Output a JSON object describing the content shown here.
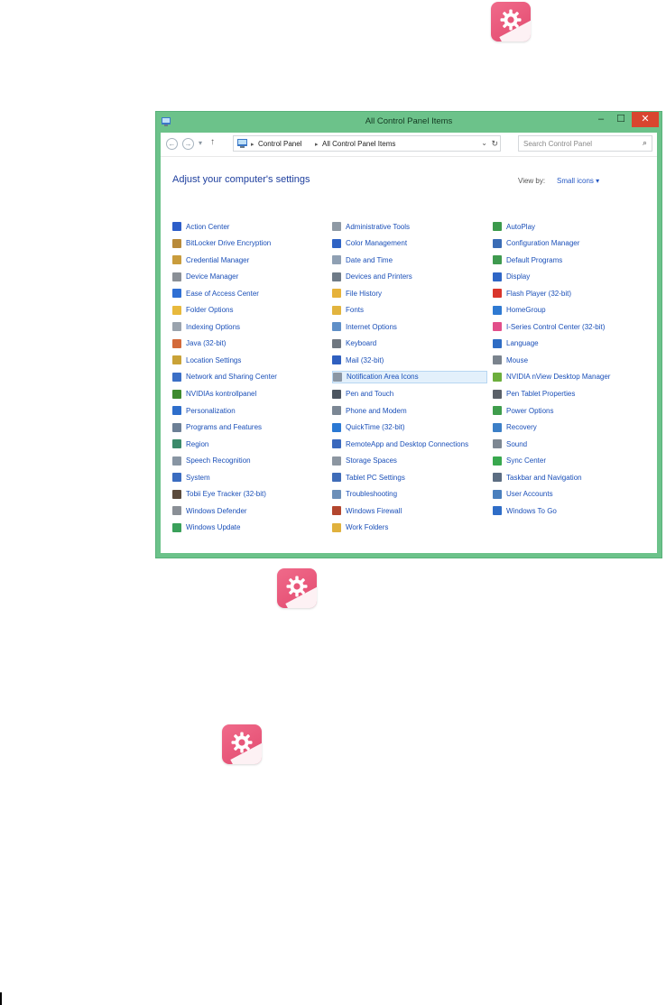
{
  "window": {
    "title": "All Control Panel Items",
    "min": "–",
    "max": "☐",
    "close": "✕"
  },
  "address": {
    "back": "←",
    "forward": "→",
    "up": "↑",
    "crumbs": [
      "Control Panel",
      "All Control Panel Items"
    ],
    "search_placeholder": "Search Control Panel"
  },
  "heading": "Adjust your computer's settings",
  "view_by_label": "View by:",
  "view_by_value": "Small icons ▾",
  "items": [
    [
      {
        "label": "Action Center",
        "icon": "flag-icon",
        "color": "#2d5ec9"
      },
      {
        "label": "BitLocker Drive Encryption",
        "icon": "bitlocker-icon",
        "color": "#b88a3a"
      },
      {
        "label": "Credential Manager",
        "icon": "vault-icon",
        "color": "#c99c3c"
      },
      {
        "label": "Device Manager",
        "icon": "device-manager-icon",
        "color": "#8a8f96"
      },
      {
        "label": "Ease of Access Center",
        "icon": "ease-of-access-icon",
        "color": "#2f6fd3"
      },
      {
        "label": "Folder Options",
        "icon": "folder-icon",
        "color": "#e8b93c"
      },
      {
        "label": "Indexing Options",
        "icon": "indexing-icon",
        "color": "#9aa3ad"
      },
      {
        "label": "Java (32-bit)",
        "icon": "java-icon",
        "color": "#d36a3a"
      },
      {
        "label": "Location Settings",
        "icon": "location-icon",
        "color": "#c9a237"
      },
      {
        "label": "Network and Sharing Center",
        "icon": "network-icon",
        "color": "#3b6fc6"
      },
      {
        "label": "NVIDIAs kontrollpanel",
        "icon": "nvidia-icon",
        "color": "#3e8a2e"
      },
      {
        "label": "Personalization",
        "icon": "personalization-icon",
        "color": "#2e6ecb"
      },
      {
        "label": "Programs and Features",
        "icon": "programs-icon",
        "color": "#6c7f95"
      },
      {
        "label": "Region",
        "icon": "region-icon",
        "color": "#3b8a6a"
      },
      {
        "label": "Speech Recognition",
        "icon": "microphone-icon",
        "color": "#8895a3"
      },
      {
        "label": "System",
        "icon": "system-icon",
        "color": "#3a6cc0"
      },
      {
        "label": "Tobii Eye Tracker (32-bit)",
        "icon": "tobii-icon",
        "color": "#5a4a3c"
      },
      {
        "label": "Windows Defender",
        "icon": "defender-icon",
        "color": "#8a8f96"
      },
      {
        "label": "Windows Update",
        "icon": "windows-update-icon",
        "color": "#3aa05a"
      }
    ],
    [
      {
        "label": "Administrative Tools",
        "icon": "admin-tools-icon",
        "color": "#8e99a4"
      },
      {
        "label": "Color Management",
        "icon": "color-management-icon",
        "color": "#2f63c4"
      },
      {
        "label": "Date and Time",
        "icon": "clock-icon",
        "color": "#8fa0b3"
      },
      {
        "label": "Devices and Printers",
        "icon": "printer-icon",
        "color": "#6e7a87"
      },
      {
        "label": "File History",
        "icon": "file-history-icon",
        "color": "#e6b23a"
      },
      {
        "label": "Fonts",
        "icon": "fonts-icon",
        "color": "#e2b43e"
      },
      {
        "label": "Internet Options",
        "icon": "internet-icon",
        "color": "#5f8fc7"
      },
      {
        "label": "Keyboard",
        "icon": "keyboard-icon",
        "color": "#6f7780"
      },
      {
        "label": "Mail (32-bit)",
        "icon": "mail-icon",
        "color": "#2f5fbf"
      },
      {
        "label": "Notification Area Icons",
        "icon": "notification-icon",
        "color": "#8a96a4"
      },
      {
        "label": "Pen and Touch",
        "icon": "pen-icon",
        "color": "#4c5560"
      },
      {
        "label": "Phone and Modem",
        "icon": "phone-icon",
        "color": "#7b8794"
      },
      {
        "label": "QuickTime (32-bit)",
        "icon": "quicktime-icon",
        "color": "#2a78d3"
      },
      {
        "label": "RemoteApp and Desktop Connections",
        "icon": "remoteapp-icon",
        "color": "#3a68bd"
      },
      {
        "label": "Storage Spaces",
        "icon": "storage-icon",
        "color": "#8c96a1"
      },
      {
        "label": "Tablet PC Settings",
        "icon": "tablet-icon",
        "color": "#3f6cb8"
      },
      {
        "label": "Troubleshooting",
        "icon": "troubleshooting-icon",
        "color": "#6c8fb8"
      },
      {
        "label": "Windows Firewall",
        "icon": "firewall-icon",
        "color": "#b3462e"
      },
      {
        "label": "Work Folders",
        "icon": "work-folders-icon",
        "color": "#e0b13d"
      }
    ],
    [
      {
        "label": "AutoPlay",
        "icon": "autoplay-icon",
        "color": "#3c9a4c"
      },
      {
        "label": "Configuration Manager",
        "icon": "config-manager-icon",
        "color": "#3a6cb5"
      },
      {
        "label": "Default Programs",
        "icon": "default-programs-icon",
        "color": "#3f9a4f"
      },
      {
        "label": "Display",
        "icon": "display-icon",
        "color": "#2f66c6"
      },
      {
        "label": "Flash Player (32-bit)",
        "icon": "flash-icon",
        "color": "#d9352c"
      },
      {
        "label": "HomeGroup",
        "icon": "homegroup-icon",
        "color": "#2f7ad2"
      },
      {
        "label": "I-Series Control Center (32-bit)",
        "icon": "iseries-icon",
        "color": "#e24f8a"
      },
      {
        "label": "Language",
        "icon": "language-icon",
        "color": "#2e6cc4"
      },
      {
        "label": "Mouse",
        "icon": "mouse-icon",
        "color": "#7a838d"
      },
      {
        "label": "NVIDIA nView Desktop Manager",
        "icon": "nview-icon",
        "color": "#6cae3c"
      },
      {
        "label": "Pen Tablet Properties",
        "icon": "pen-tablet-icon",
        "color": "#5a6068"
      },
      {
        "label": "Power Options",
        "icon": "power-icon",
        "color": "#3f9d4c"
      },
      {
        "label": "Recovery",
        "icon": "recovery-icon",
        "color": "#3c7fc7"
      },
      {
        "label": "Sound",
        "icon": "sound-icon",
        "color": "#7d8792"
      },
      {
        "label": "Sync Center",
        "icon": "sync-icon",
        "color": "#38a84e"
      },
      {
        "label": "Taskbar and Navigation",
        "icon": "taskbar-icon",
        "color": "#5c6d82"
      },
      {
        "label": "User Accounts",
        "icon": "user-accounts-icon",
        "color": "#4a7fbd"
      },
      {
        "label": "Windows To Go",
        "icon": "windows-to-go-icon",
        "color": "#2f6dc7"
      }
    ]
  ],
  "selected_item": "Notification Area Icons"
}
